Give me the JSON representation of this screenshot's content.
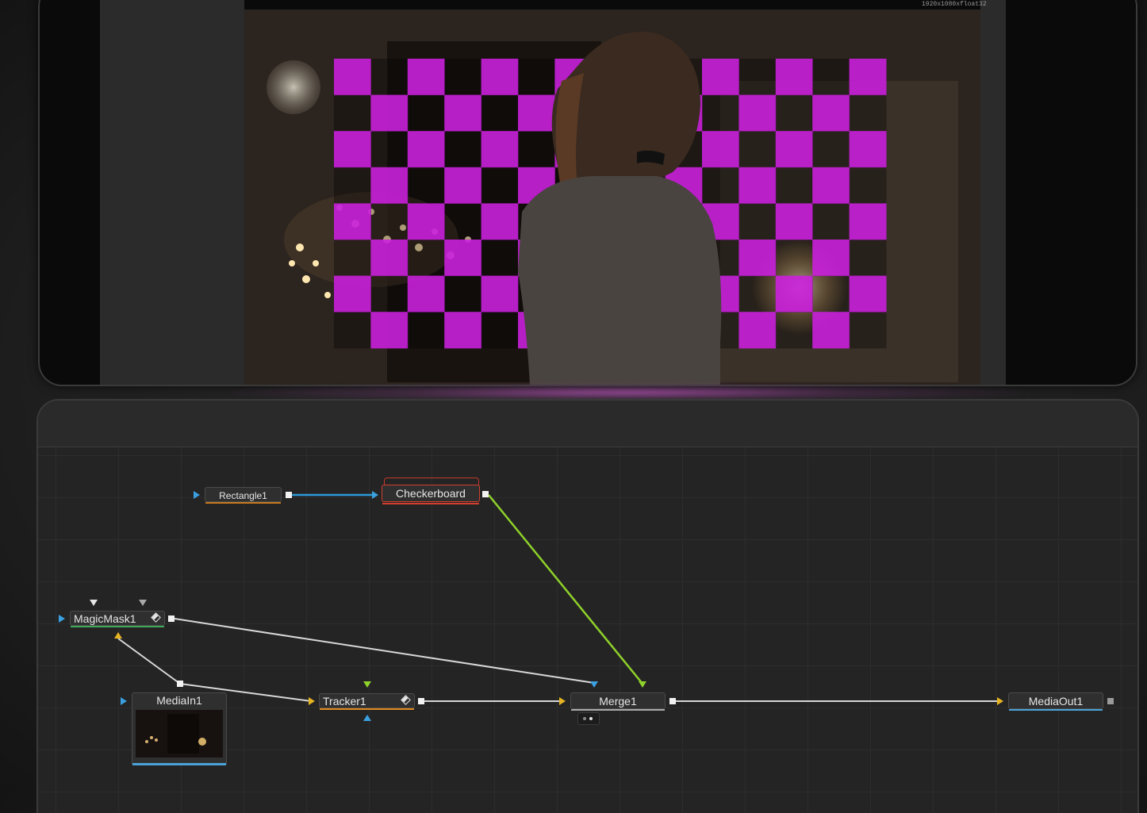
{
  "viewer": {
    "resolution_label": "1920x1080xfloat32",
    "overlay_color": "#c41fd6"
  },
  "nodes": {
    "rectangle": {
      "label": "Rectangle1",
      "bar_color": "#c97a1e"
    },
    "checkerboard": {
      "label": "Checkerboard",
      "bar_color": "#d04030"
    },
    "magicmask": {
      "label": "MagicMask1",
      "bar_color": "#3fa85a"
    },
    "mediain": {
      "label": "MediaIn1",
      "bar_color": "#4aa3d8"
    },
    "tracker": {
      "label": "Tracker1",
      "bar_color": "#e08a1e"
    },
    "merge": {
      "label": "Merge1",
      "bar_color": "#aaaaaa"
    },
    "mediaout": {
      "label": "MediaOut1",
      "bar_color": "#4aa3d8"
    }
  },
  "wire_colors": {
    "blue": "#2e9ad8",
    "green": "#8fd22a",
    "white": "#d8d8d8"
  }
}
